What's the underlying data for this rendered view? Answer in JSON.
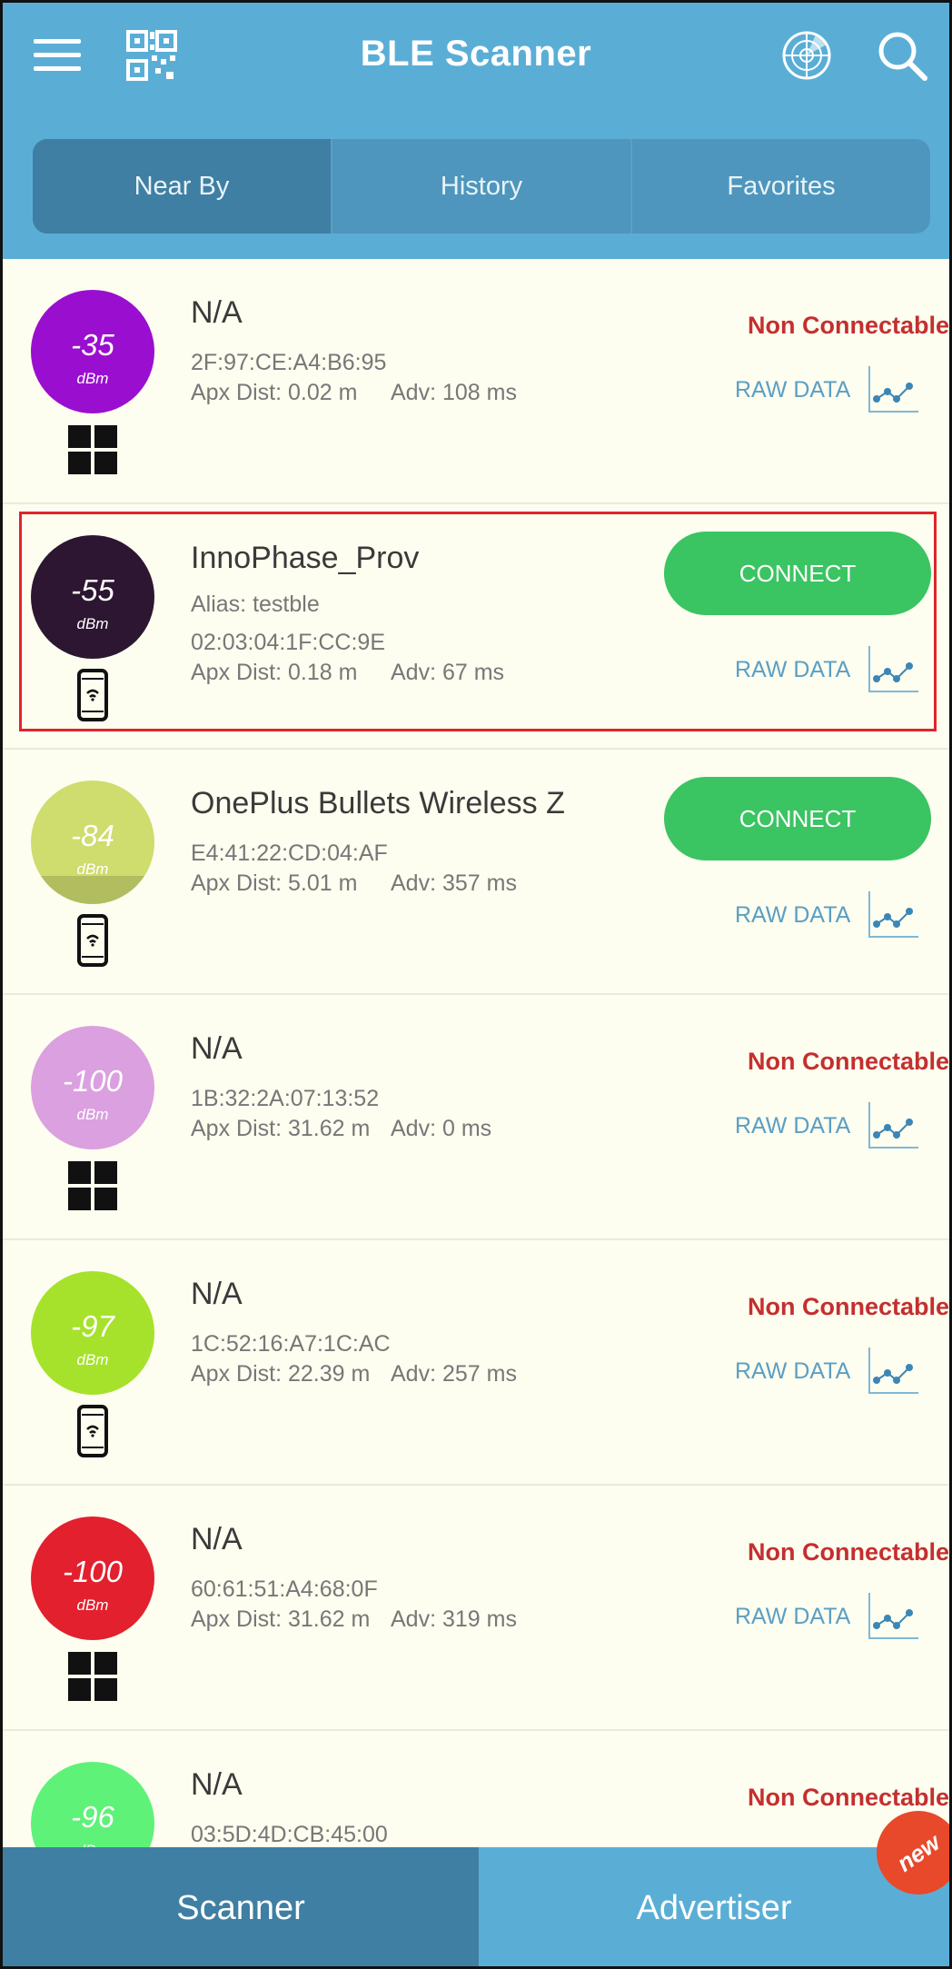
{
  "app": {
    "title": "BLE Scanner"
  },
  "tabs": [
    {
      "label": "Near By",
      "active": true
    },
    {
      "label": "History",
      "active": false
    },
    {
      "label": "Favorites",
      "active": false
    }
  ],
  "raw_label": "RAW DATA",
  "devices": [
    {
      "rssi": "-35",
      "unit": "dBm",
      "color": "#9a0fcf",
      "icon": "windows-icon",
      "name": "N/A",
      "alias": "",
      "mac": "2F:97:CE:A4:B6:95",
      "dist": "Apx Dist: 0.02 m",
      "adv": "Adv: 108 ms",
      "status": "Non Connectable"
    },
    {
      "rssi": "-55",
      "unit": "dBm",
      "color": "#2d1631",
      "icon": "phone-icon",
      "name": "InnoPhase_Prov",
      "alias": "Alias: testble",
      "mac": "02:03:04:1F:CC:9E",
      "dist": "Apx Dist: 0.18 m",
      "adv": "Adv: 67 ms",
      "status": "CONNECT"
    },
    {
      "rssi": "-84",
      "unit": "dBm",
      "color": "#cfdc6e",
      "icon": "phone-icon",
      "name": "OnePlus Bullets Wireless Z",
      "alias": "",
      "mac": "E4:41:22:CD:04:AF",
      "dist": "Apx Dist: 5.01 m",
      "adv": "Adv: 357 ms",
      "status": "CONNECT"
    },
    {
      "rssi": "-100",
      "unit": "dBm",
      "color": "#dba0e0",
      "icon": "windows-icon",
      "name": "N/A",
      "alias": "",
      "mac": "1B:32:2A:07:13:52",
      "dist": "Apx Dist: 31.62 m",
      "adv": "Adv: 0 ms",
      "status": "Non Connectable"
    },
    {
      "rssi": "-97",
      "unit": "dBm",
      "color": "#a6e22b",
      "icon": "phone-icon",
      "name": "N/A",
      "alias": "",
      "mac": "1C:52:16:A7:1C:AC",
      "dist": "Apx Dist: 22.39 m",
      "adv": "Adv: 257 ms",
      "status": "Non Connectable"
    },
    {
      "rssi": "-100",
      "unit": "dBm",
      "color": "#e2202e",
      "icon": "windows-icon",
      "name": "N/A",
      "alias": "",
      "mac": "60:61:51:A4:68:0F",
      "dist": "Apx Dist: 31.62 m",
      "adv": "Adv: 319 ms",
      "status": "Non Connectable"
    },
    {
      "rssi": "-96",
      "unit": "dBm",
      "color": "#5ef279",
      "icon": "phone-icon",
      "name": "N/A",
      "alias": "",
      "mac": "03:5D:4D:CB:45:00",
      "dist": "",
      "adv": "",
      "status": "Non Connectable"
    }
  ],
  "bottom_tabs": {
    "scanner": "Scanner",
    "advertiser": "Advertiser",
    "badge": "new"
  }
}
